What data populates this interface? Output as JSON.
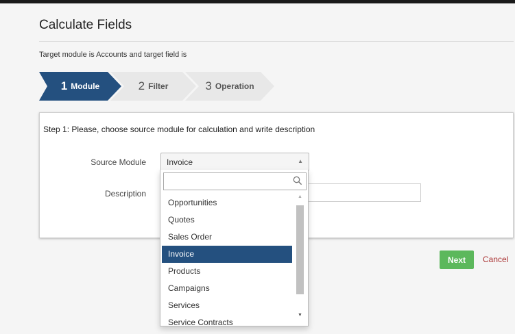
{
  "page": {
    "title": "Calculate Fields",
    "subtitle": "Target module is Accounts and target field is"
  },
  "wizard": {
    "steps": [
      {
        "number": "1",
        "label": "Module",
        "active": true
      },
      {
        "number": "2",
        "label": "Filter",
        "active": false
      },
      {
        "number": "3",
        "label": "Operation",
        "active": false
      }
    ]
  },
  "panel": {
    "heading": "Step 1: Please, choose source module for calculation and write description",
    "source_module_label": "Source Module",
    "source_module_value": "Invoice",
    "description_label": "Description",
    "description_value": ""
  },
  "dropdown": {
    "search_value": "",
    "options": [
      "Opportunities",
      "Quotes",
      "Sales Order",
      "Invoice",
      "Products",
      "Campaigns",
      "Services",
      "Service Contracts"
    ],
    "selected": "Invoice"
  },
  "actions": {
    "next_label": "Next",
    "cancel_label": "Cancel"
  },
  "colors": {
    "active_step": "#24507f",
    "next_button": "#5cb85c",
    "cancel_link": "#aa3333"
  }
}
